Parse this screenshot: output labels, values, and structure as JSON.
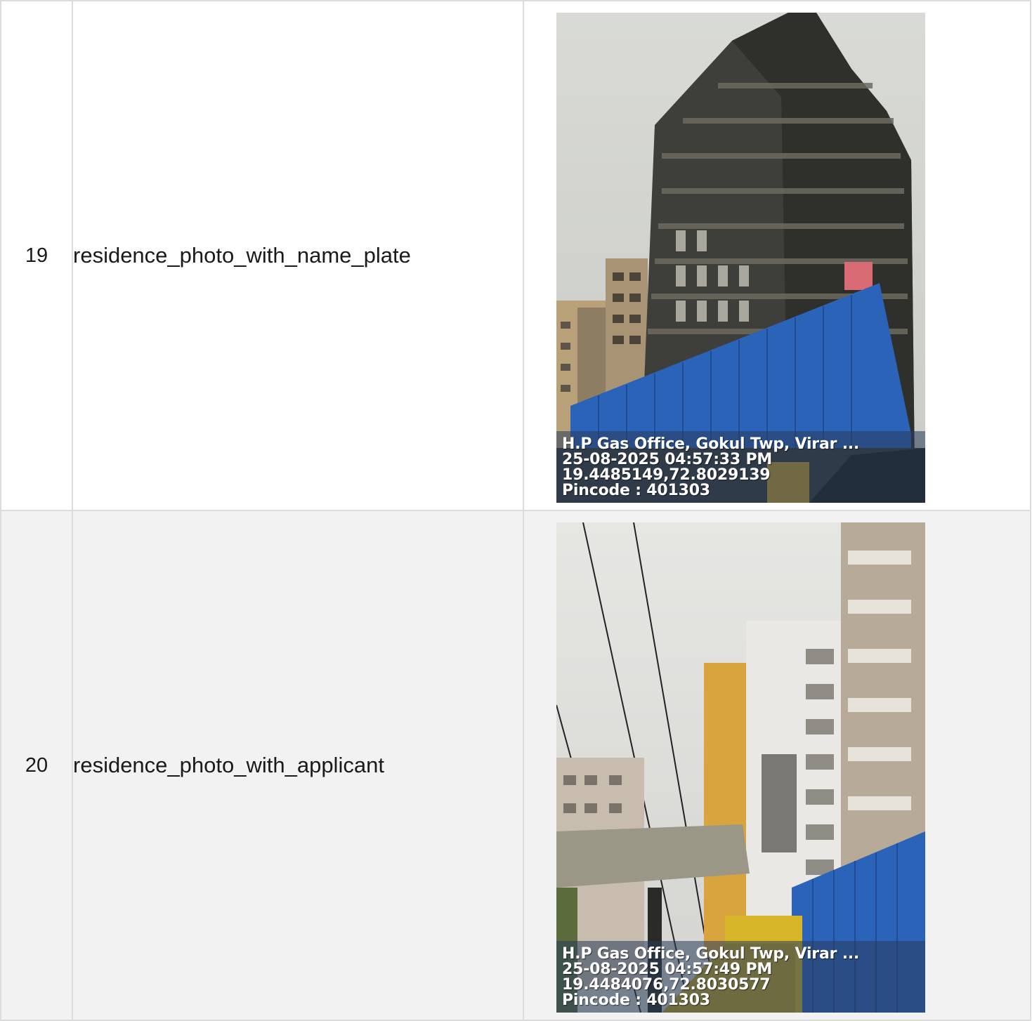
{
  "rows": [
    {
      "number": "19",
      "field": "residence_photo_with_name_plate",
      "photo": {
        "icon": "building-photo",
        "stamp_address": "H.P Gas Office, Gokul Twp, Virar ...",
        "stamp_datetime": "25-08-2025 04:57:33 PM",
        "stamp_coords": "19.4485149,72.8029139",
        "stamp_pincode": "Pincode : 401303"
      }
    },
    {
      "number": "20",
      "field": "residence_photo_with_applicant",
      "photo": {
        "icon": "street-photo",
        "stamp_address": "H.P Gas Office, Gokul Twp, Virar ...",
        "stamp_datetime": "25-08-2025 04:57:49 PM",
        "stamp_coords": "19.4484076,72.8030577",
        "stamp_pincode": "Pincode : 401303"
      }
    }
  ],
  "colors": {
    "border": "#dcdcdc",
    "row_alt": "#f2f2f2",
    "fence_blue": "#2b63b8"
  }
}
